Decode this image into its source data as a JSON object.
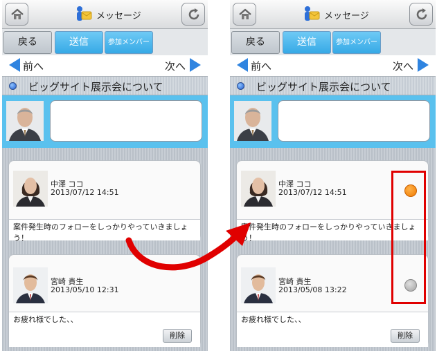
{
  "header": {
    "title": "メッセージ",
    "home_icon": "home-icon",
    "reload_icon": "reload-icon",
    "app_icon": "message-app-icon"
  },
  "buttons": {
    "back": "戻る",
    "send": "送信",
    "members": "参加メンバー"
  },
  "nav": {
    "prev": "前へ",
    "next": "次へ"
  },
  "thread": {
    "subject": "ビッグサイト展示会について"
  },
  "left": {
    "messages": [
      {
        "name": "中澤 ココ",
        "time": "2013/07/12 14:51",
        "body": "案件発生時のフォローをしっかりやっていきましょう！"
      },
      {
        "name": "宮崎 貴生",
        "time": "2013/05/10 12:31",
        "body": "お疲れ様でした、、",
        "delete_label": "削除"
      }
    ]
  },
  "right": {
    "messages": [
      {
        "name": "中澤 ココ",
        "time": "2013/07/12 14:51",
        "body": "案件発生時のフォローをしっかりやっていきましょう！",
        "selected": true
      },
      {
        "name": "宮崎 貴生",
        "time": "2013/05/08 13:22",
        "body": "お疲れ様でした、、",
        "delete_label": "削除",
        "selected": false
      }
    ]
  },
  "colors": {
    "accent": "#5ac1ee",
    "send_button": "#36a9e6",
    "nav_arrow": "#2f84e0",
    "selected_radio": "#f07a00",
    "highlight": "#e00000",
    "transition_arrow": "#e00000"
  }
}
